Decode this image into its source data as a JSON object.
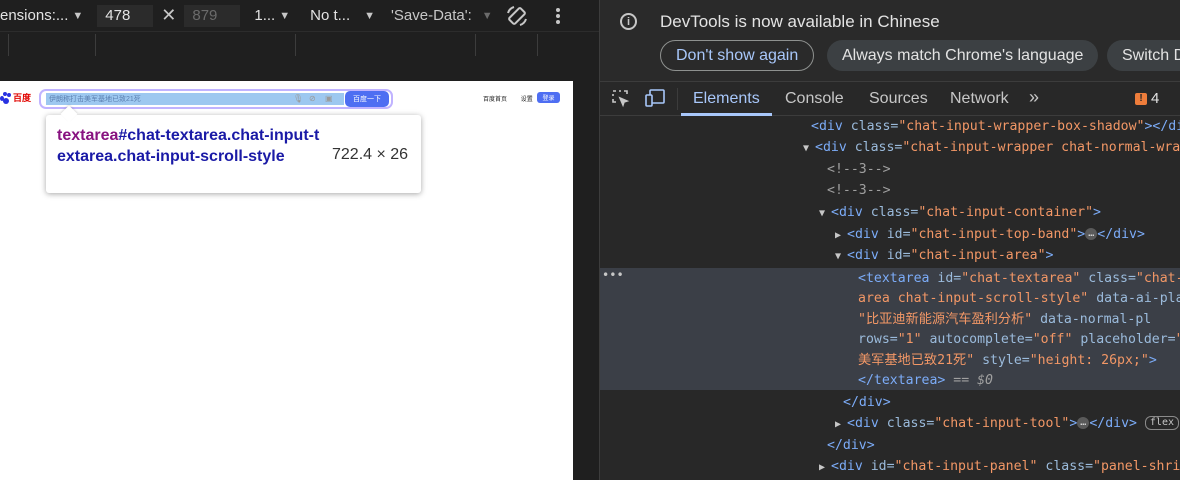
{
  "device_toolbar": {
    "dimensions_label": "ensions:...",
    "width_value": "478",
    "height_value": "879",
    "dpr_label": "1...",
    "throttle_label": "No t...",
    "save_data_label": "'Save-Data':"
  },
  "page": {
    "logo_text": "百度",
    "search_placeholder": "伊朗称打击美军基地已致21死",
    "search_button": "百度一下",
    "top_links": [
      "百度首页",
      "设置"
    ],
    "login_button": "登录"
  },
  "tooltip": {
    "tag": "textarea",
    "selector": "#chat-textarea.chat-input-textarea.chat-input-scroll-style",
    "size": "722.4 × 26"
  },
  "infobar": {
    "message": "DevTools is now available in Chinese",
    "buttons": [
      "Don't show again",
      "Always match Chrome's language",
      "Switch D"
    ]
  },
  "tabs": [
    {
      "label": "Elements",
      "active": true
    },
    {
      "label": "Console",
      "active": false
    },
    {
      "label": "Sources",
      "active": false
    },
    {
      "label": "Network",
      "active": false
    }
  ],
  "issues_count": "4",
  "colors": {
    "accent": "#a8c7fa",
    "tag": "#7cacf8",
    "attr": "#9bbbdc",
    "value": "#f29766",
    "issue": "#ee7d3b",
    "search_button": "#4e6ef2",
    "logo_red": "#e10602"
  },
  "icons": [
    "info-icon",
    "inspect-element-icon",
    "device-toolbar-icon",
    "chevron-double-right-icon",
    "issue-icon",
    "rotate-icon",
    "more-vert-icon",
    "dropdown-arrow-icon",
    "close-icon"
  ],
  "dom_tree": {
    "line1": {
      "tag_open": "<div ",
      "attr": "class=",
      "val": "\"chat-input-wrapper-box-shadow\"",
      "tag_close": "></div>"
    },
    "line2": {
      "tag_open": "<div ",
      "attr": "class=",
      "val": "\"chat-input-wrapper chat-normal-wra"
    },
    "line3": "<!--3-->",
    "line4": "<!--3-->",
    "line5": {
      "tag_open": "<div ",
      "attr": "class=",
      "val": "\"chat-input-container\"",
      "tag_close": ">"
    },
    "line6": {
      "tag_open": "<div ",
      "attr": "id=",
      "val": "\"chat-input-top-band\"",
      "mid": ">",
      "tag_close": "</div>"
    },
    "line7": {
      "tag_open": "<div ",
      "attr": "id=",
      "val": "\"chat-input-area\"",
      "tag_close": ">"
    },
    "line8": {
      "tag_open": "<textarea ",
      "attr1": "id=",
      "val1": "\"chat-textarea\"",
      "attr2": " class=",
      "val2": "\"chat-"
    },
    "line9": {
      "val": "area chat-input-scroll-style\"",
      "attr": " data-ai-pla"
    },
    "line10": {
      "val": "\"比亚迪新能源汽车盈利分析\"",
      "attr": " data-normal-pl"
    },
    "line11": {
      "attr1": "rows=",
      "val1": "\"1\"",
      "attr2": " autocomplete=",
      "val2": "\"off\"",
      "attr3": " placeholder=",
      "val3": "\""
    },
    "line12": {
      "val1": "美军基地已致21死\"",
      "attr": " style=",
      "val2": "\"height: 26px;\"",
      "tag_close": ">"
    },
    "line13": {
      "tag": "</textarea>",
      "eq": " == $0"
    },
    "line14": "</div>",
    "line15": {
      "tag_open": "<div ",
      "attr": "class=",
      "val": "\"chat-input-tool\"",
      "mid": ">",
      "tag_close": "</div>",
      "badge": "flex"
    },
    "line16": "</div>",
    "line17": {
      "tag_open": "<div ",
      "attr1": "id=",
      "val1": "\"chat-input-panel\"",
      "attr2": " class=",
      "val2": "\"panel-shri"
    },
    "ellipsis": "…",
    "dots": "•••"
  }
}
